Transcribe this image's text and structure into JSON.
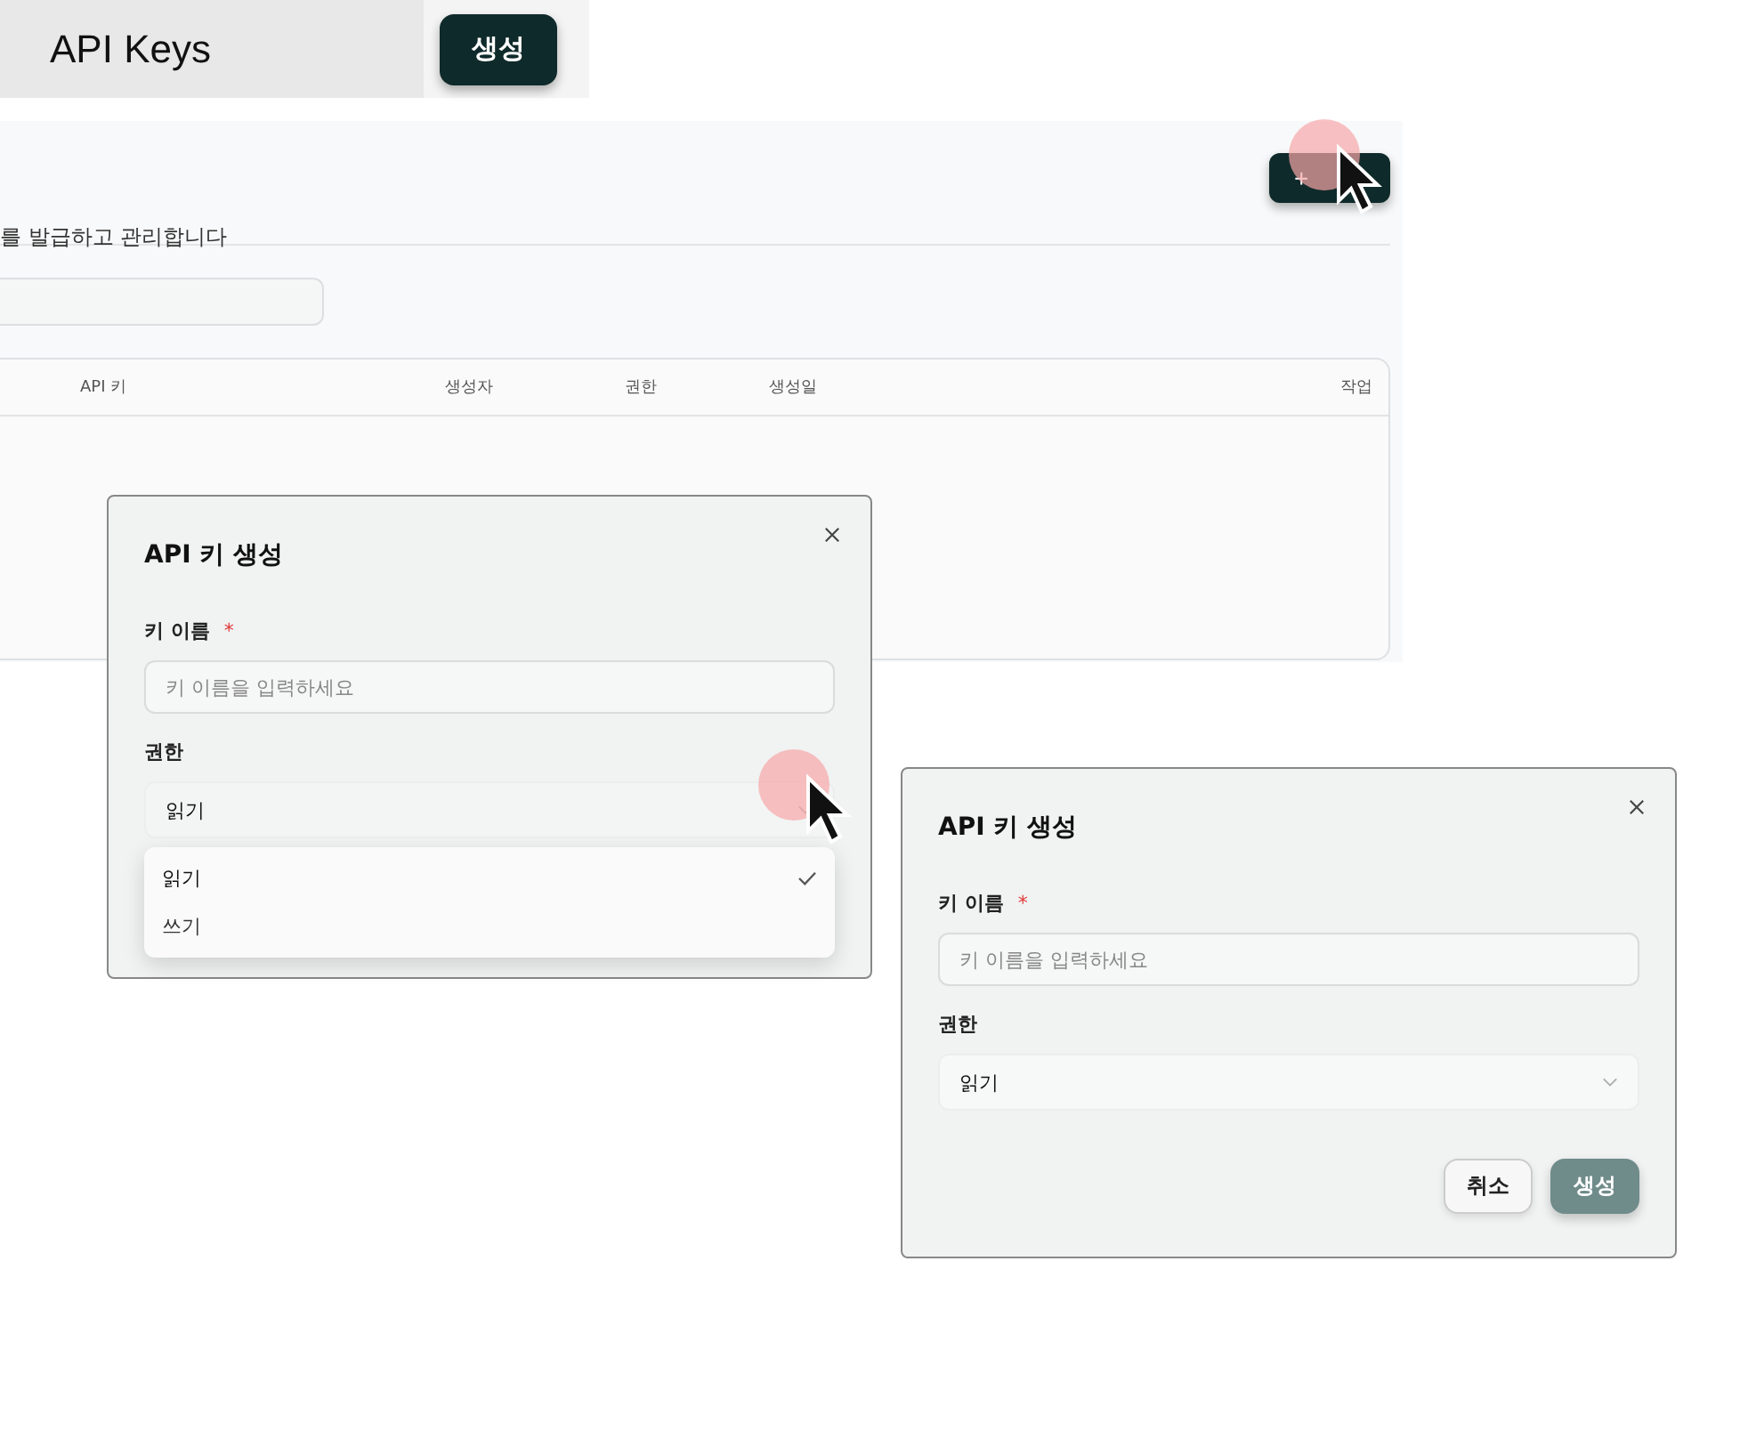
{
  "header_strip": {
    "title": "API Keys",
    "create_button": "생성"
  },
  "page": {
    "subtitle": "를 발급하고 관리합니다",
    "add_button": "+",
    "table": {
      "columns": [
        "API 키",
        "생성자",
        "권한",
        "생성일",
        "작업"
      ]
    }
  },
  "dialogs": [
    {
      "title": "API 키 생성",
      "name_label": "키 이름",
      "required_mark": "*",
      "name_placeholder": "키 이름을 입력하세요",
      "permission_label": "권한",
      "permission_value": "읽기",
      "dropdown_open": true,
      "options": [
        {
          "label": "읽기",
          "selected": true
        },
        {
          "label": "쓰기",
          "selected": false
        }
      ]
    },
    {
      "title": "API 키 생성",
      "name_label": "키 이름",
      "required_mark": "*",
      "name_placeholder": "키 이름을 입력하세요",
      "permission_label": "권한",
      "permission_value": "읽기",
      "dropdown_open": false,
      "buttons": [
        {
          "label": "취소",
          "kind": "secondary"
        },
        {
          "label": "생성",
          "kind": "primary"
        }
      ]
    }
  ]
}
